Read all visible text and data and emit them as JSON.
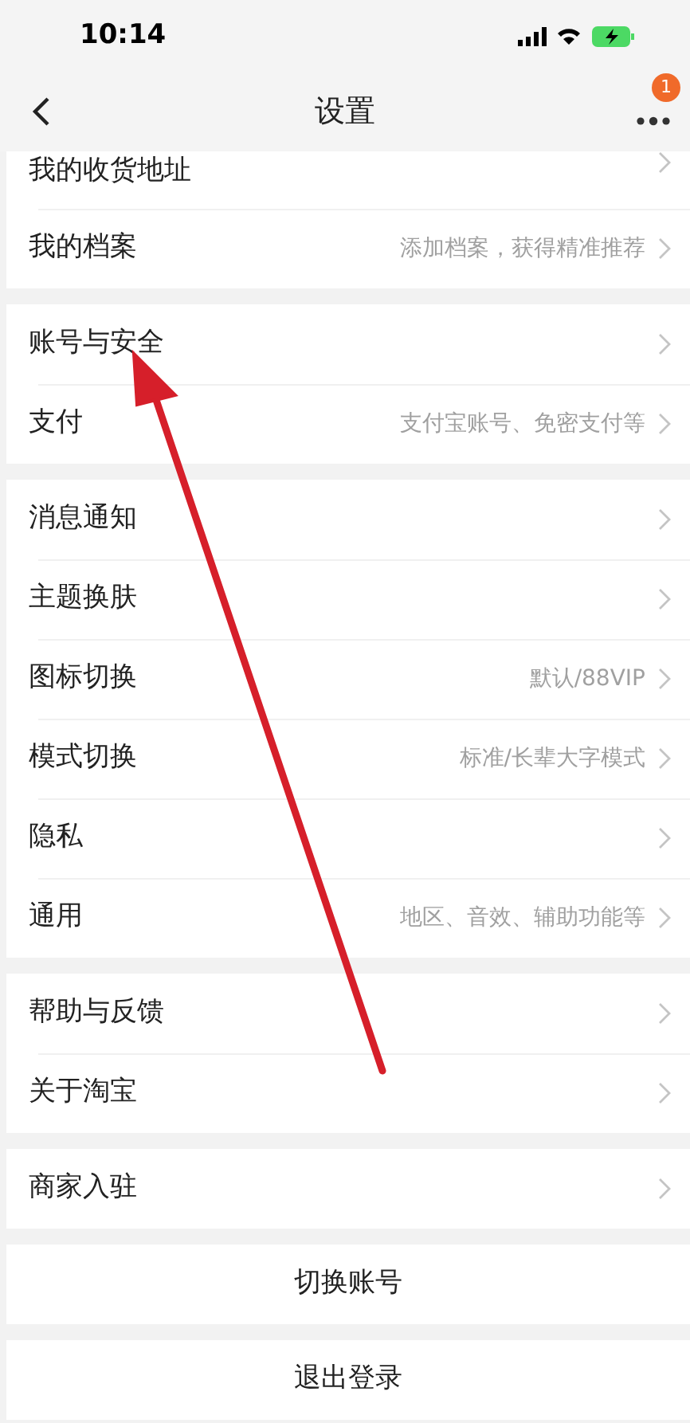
{
  "status_bar": {
    "time": "10:14"
  },
  "nav": {
    "title": "设置",
    "badge": "1"
  },
  "groups": [
    {
      "rows": [
        {
          "label": "我的收货地址"
        },
        {
          "label": "我的档案",
          "hint": "添加档案，获得精准推荐"
        }
      ]
    },
    {
      "rows": [
        {
          "label": "账号与安全"
        },
        {
          "label": "支付",
          "hint": "支付宝账号、免密支付等"
        }
      ]
    },
    {
      "rows": [
        {
          "label": "消息通知"
        },
        {
          "label": "主题换肤"
        },
        {
          "label": "图标切换",
          "hint": "默认/88VIP"
        },
        {
          "label": "模式切换",
          "hint": "标准/长辈大字模式"
        },
        {
          "label": "隐私"
        },
        {
          "label": "通用",
          "hint": "地区、音效、辅助功能等"
        }
      ]
    },
    {
      "rows": [
        {
          "label": "帮助与反馈"
        },
        {
          "label": "关于淘宝"
        }
      ]
    },
    {
      "rows": [
        {
          "label": "商家入驻"
        }
      ]
    }
  ],
  "actions": [
    "切换账号",
    "退出登录"
  ]
}
